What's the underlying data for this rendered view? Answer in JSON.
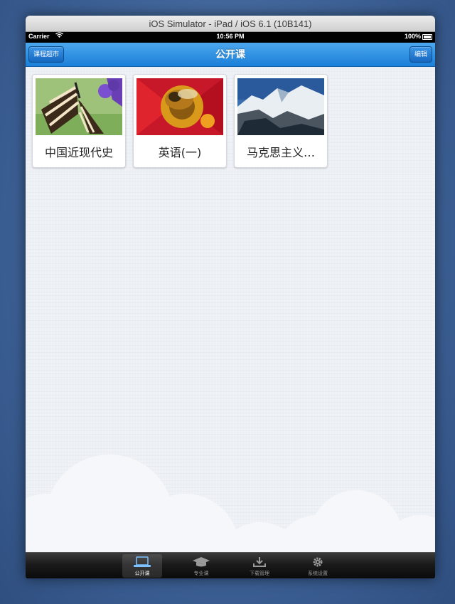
{
  "window": {
    "title": "iOS Simulator - iPad / iOS 6.1 (10B141)"
  },
  "status_bar": {
    "carrier": "Carrier",
    "time": "10:56 PM",
    "battery": "100%"
  },
  "navbar": {
    "title": "公开课",
    "left_button": "课程超市",
    "right_button": "编辑"
  },
  "courses": [
    {
      "title": "中国近现代史",
      "image": "butterfly-photo"
    },
    {
      "title": "英语(一)",
      "image": "bee-on-flower-photo"
    },
    {
      "title": "马克思主义…",
      "image": "snowy-mountains-photo"
    }
  ],
  "tabbar": {
    "selected": 0,
    "items": [
      {
        "label": "公开课",
        "icon": "laptop-icon"
      },
      {
        "label": "专业课",
        "icon": "graduation-cap-icon"
      },
      {
        "label": "下载管理",
        "icon": "download-icon"
      },
      {
        "label": "系统设置",
        "icon": "gear-icon"
      }
    ]
  },
  "colors": {
    "navbar": "#1b7fd8",
    "tabbar": "#1a1a1a",
    "content_bg": "#edf0f5"
  }
}
